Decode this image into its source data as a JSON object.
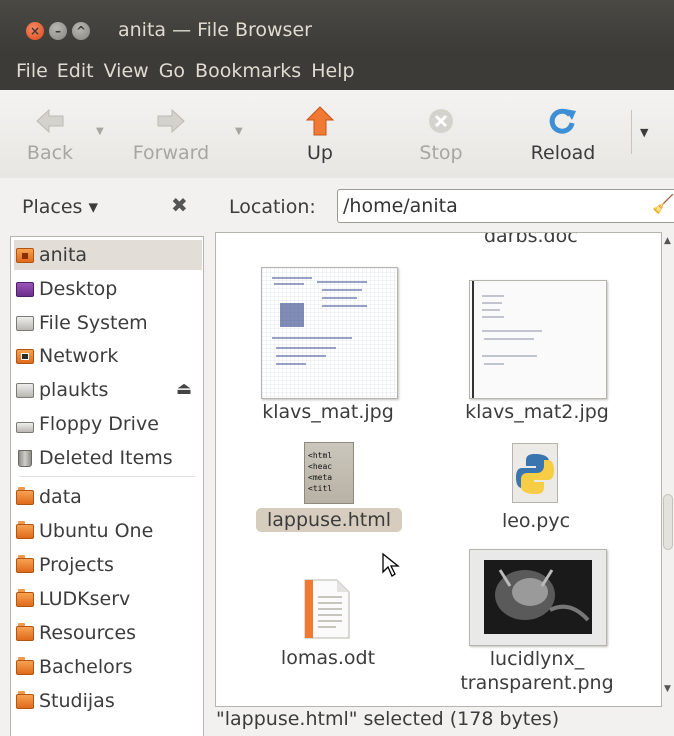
{
  "window": {
    "title": "anita — File Browser"
  },
  "menu": [
    "File",
    "Edit",
    "View",
    "Go",
    "Bookmarks",
    "Help"
  ],
  "toolbar": {
    "back": "Back",
    "forward": "Forward",
    "up": "Up",
    "stop": "Stop",
    "reload": "Reload"
  },
  "places": {
    "label": "Places ▾"
  },
  "location": {
    "label": "Location:",
    "value": "/home/anita"
  },
  "sidebar": {
    "items": [
      {
        "label": "anita",
        "icon": "home-folder-icon"
      },
      {
        "label": "Desktop",
        "icon": "desktop-icon"
      },
      {
        "label": "File System",
        "icon": "drive-icon"
      },
      {
        "label": "Network",
        "icon": "network-icon"
      },
      {
        "label": "plaukts",
        "icon": "drive-icon"
      },
      {
        "label": "Floppy Drive",
        "icon": "floppy-icon"
      },
      {
        "label": "Deleted Items",
        "icon": "trash-icon"
      },
      {
        "label": "data",
        "icon": "folder-icon"
      },
      {
        "label": "Ubuntu One",
        "icon": "folder-icon"
      },
      {
        "label": "Projects",
        "icon": "folder-icon"
      },
      {
        "label": "LUDKserv",
        "icon": "folder-icon"
      },
      {
        "label": "Resources",
        "icon": "folder-icon"
      },
      {
        "label": "Bachelors",
        "icon": "folder-icon"
      },
      {
        "label": "Studijas",
        "icon": "folder-icon"
      }
    ]
  },
  "files": {
    "cut": "darbs.doc",
    "f1": "klavs_mat.jpg",
    "f2": "klavs_mat2.jpg",
    "f3": "lappuse.html",
    "f4": "leo.pyc",
    "f5": "lomas.odt",
    "f6_line1": "lucidlynx_",
    "f6_line2": "transparent.png",
    "html_preview": [
      "<html",
      "<heac",
      "<meta",
      "<titl"
    ]
  },
  "status": "\"lappuse.html\" selected (178 bytes)",
  "colors": {
    "accent": "#dd4814",
    "selection": "#d6cdbe",
    "titlebar": "#3c3b37"
  }
}
